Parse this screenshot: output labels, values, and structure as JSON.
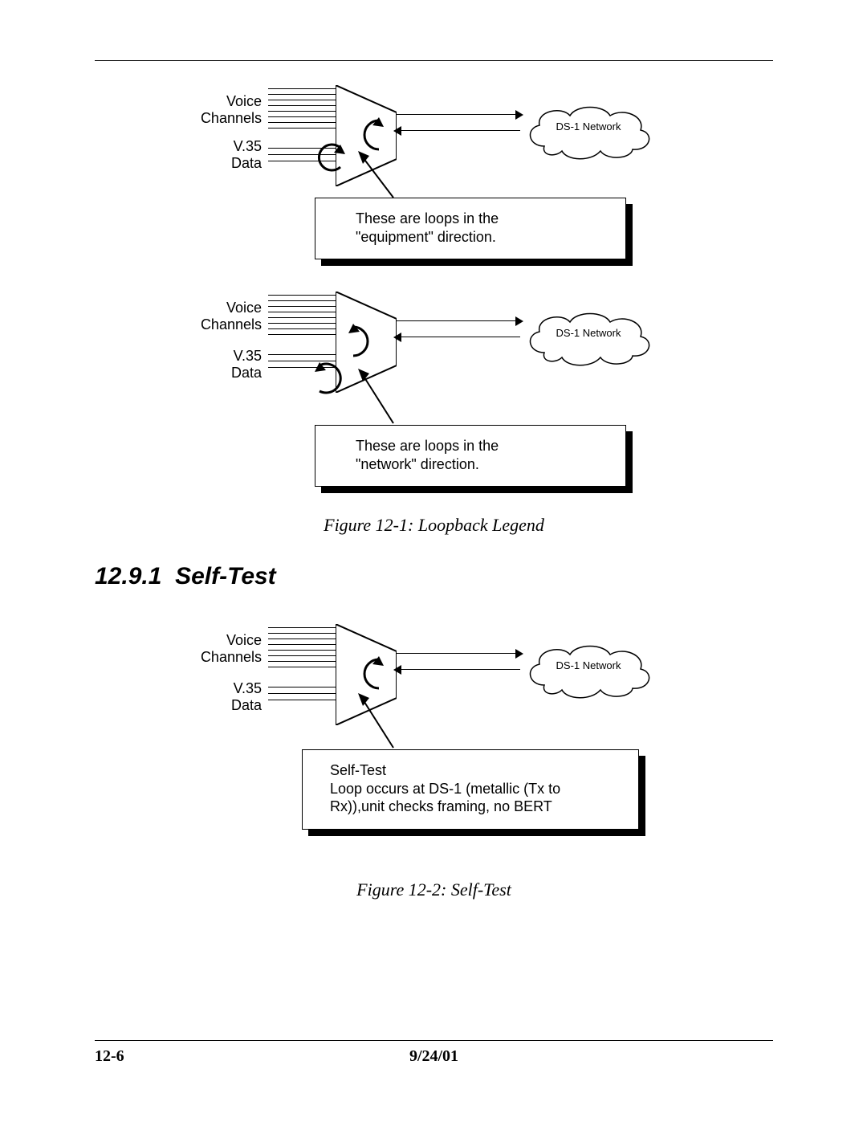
{
  "labels": {
    "voice_channels": "Voice\nChannels",
    "v35_data": "V.35\nData",
    "ds1_network": "DS-1 Network"
  },
  "callouts": {
    "equipment": "These are loops in the\n\"equipment\" direction.",
    "network": "These are loops in the\n\"network\" direction.",
    "selftest": "Self-Test\nLoop occurs at DS-1 (metallic (Tx to\nRx)),unit checks framing, no BERT"
  },
  "captions": {
    "fig1": "Figure 12-1: Loopback Legend",
    "fig2": "Figure 12-2: Self-Test"
  },
  "section": {
    "number": "12.9.1",
    "title": "Self-Test"
  },
  "footer": {
    "page": "12-6",
    "date": "9/24/01"
  }
}
